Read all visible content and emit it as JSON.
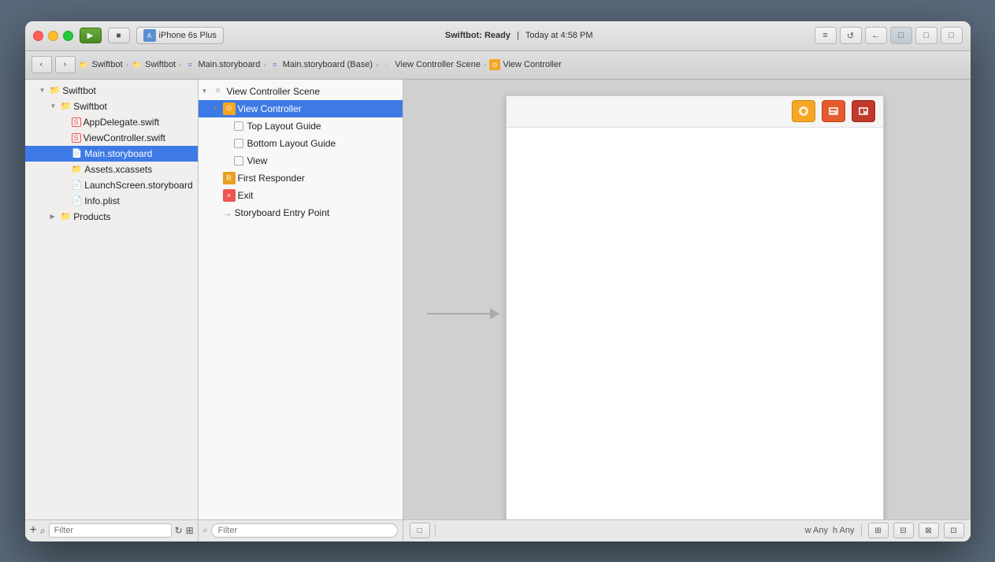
{
  "window": {
    "title": "Swiftbot"
  },
  "titlebar": {
    "scheme": "iPhone 6s Plus",
    "status": "Swiftbot: Ready",
    "timestamp": "Today at 4:58 PM"
  },
  "breadcrumb": {
    "items": [
      {
        "label": "Swiftbot",
        "type": "folder"
      },
      {
        "label": "Swiftbot",
        "type": "folder"
      },
      {
        "label": "Main.storyboard",
        "type": "storyboard"
      },
      {
        "label": "Main.storyboard (Base)",
        "type": "storyboard"
      },
      {
        "label": "View Controller Scene",
        "type": "scene"
      },
      {
        "label": "View Controller",
        "type": "vc"
      }
    ]
  },
  "file_navigator": {
    "items": [
      {
        "label": "Swiftbot",
        "indent": 0,
        "type": "group",
        "open": true
      },
      {
        "label": "Swiftbot",
        "indent": 1,
        "type": "group",
        "open": true
      },
      {
        "label": "AppDelegate.swift",
        "indent": 2,
        "type": "swift"
      },
      {
        "label": "ViewController.swift",
        "indent": 2,
        "type": "swift"
      },
      {
        "label": "Main.storyboard",
        "indent": 2,
        "type": "storyboard",
        "selected": true
      },
      {
        "label": "Assets.xcassets",
        "indent": 2,
        "type": "xcassets"
      },
      {
        "label": "LaunchScreen.storyboard",
        "indent": 2,
        "type": "storyboard"
      },
      {
        "label": "Info.plist",
        "indent": 2,
        "type": "plist"
      },
      {
        "label": "Products",
        "indent": 1,
        "type": "group",
        "open": false
      }
    ],
    "footer": {
      "add_label": "+",
      "filter_placeholder": "Filter"
    }
  },
  "scene_outline": {
    "items": [
      {
        "label": "View Controller Scene",
        "indent": 0,
        "type": "scene",
        "open": true
      },
      {
        "label": "View Controller",
        "indent": 1,
        "type": "vc",
        "open": true,
        "selected": true
      },
      {
        "label": "Top Layout Guide",
        "indent": 2,
        "type": "layout"
      },
      {
        "label": "Bottom Layout Guide",
        "indent": 2,
        "type": "layout"
      },
      {
        "label": "View",
        "indent": 2,
        "type": "view"
      },
      {
        "label": "First Responder",
        "indent": 1,
        "type": "first_responder"
      },
      {
        "label": "Exit",
        "indent": 1,
        "type": "exit"
      },
      {
        "label": "Storyboard Entry Point",
        "indent": 1,
        "type": "entry"
      }
    ],
    "footer": {
      "filter_placeholder": "Filter"
    }
  },
  "canvas": {
    "size_indicator": "w Any  h Any",
    "w_label": "w",
    "any_w": "Any",
    "h_label": "h",
    "any_h": "Any"
  },
  "icons": {
    "triangle_open": "▼",
    "triangle_closed": "▶",
    "folder": "📁",
    "swift_badge": "S",
    "storyboard_badge": "≡",
    "play": "▶",
    "stop": "■",
    "back": "‹",
    "forward": "›",
    "search": "⌕",
    "nav_left": "‹‹",
    "nav_right": "›",
    "arrow_right": "→",
    "plus": "+",
    "filter": "⊘",
    "hamburger": "≡",
    "layout_panel": "□",
    "vc_icon": "⊙",
    "fr_icon": "R",
    "exit_icon": "×",
    "entry_arrow": "→"
  }
}
